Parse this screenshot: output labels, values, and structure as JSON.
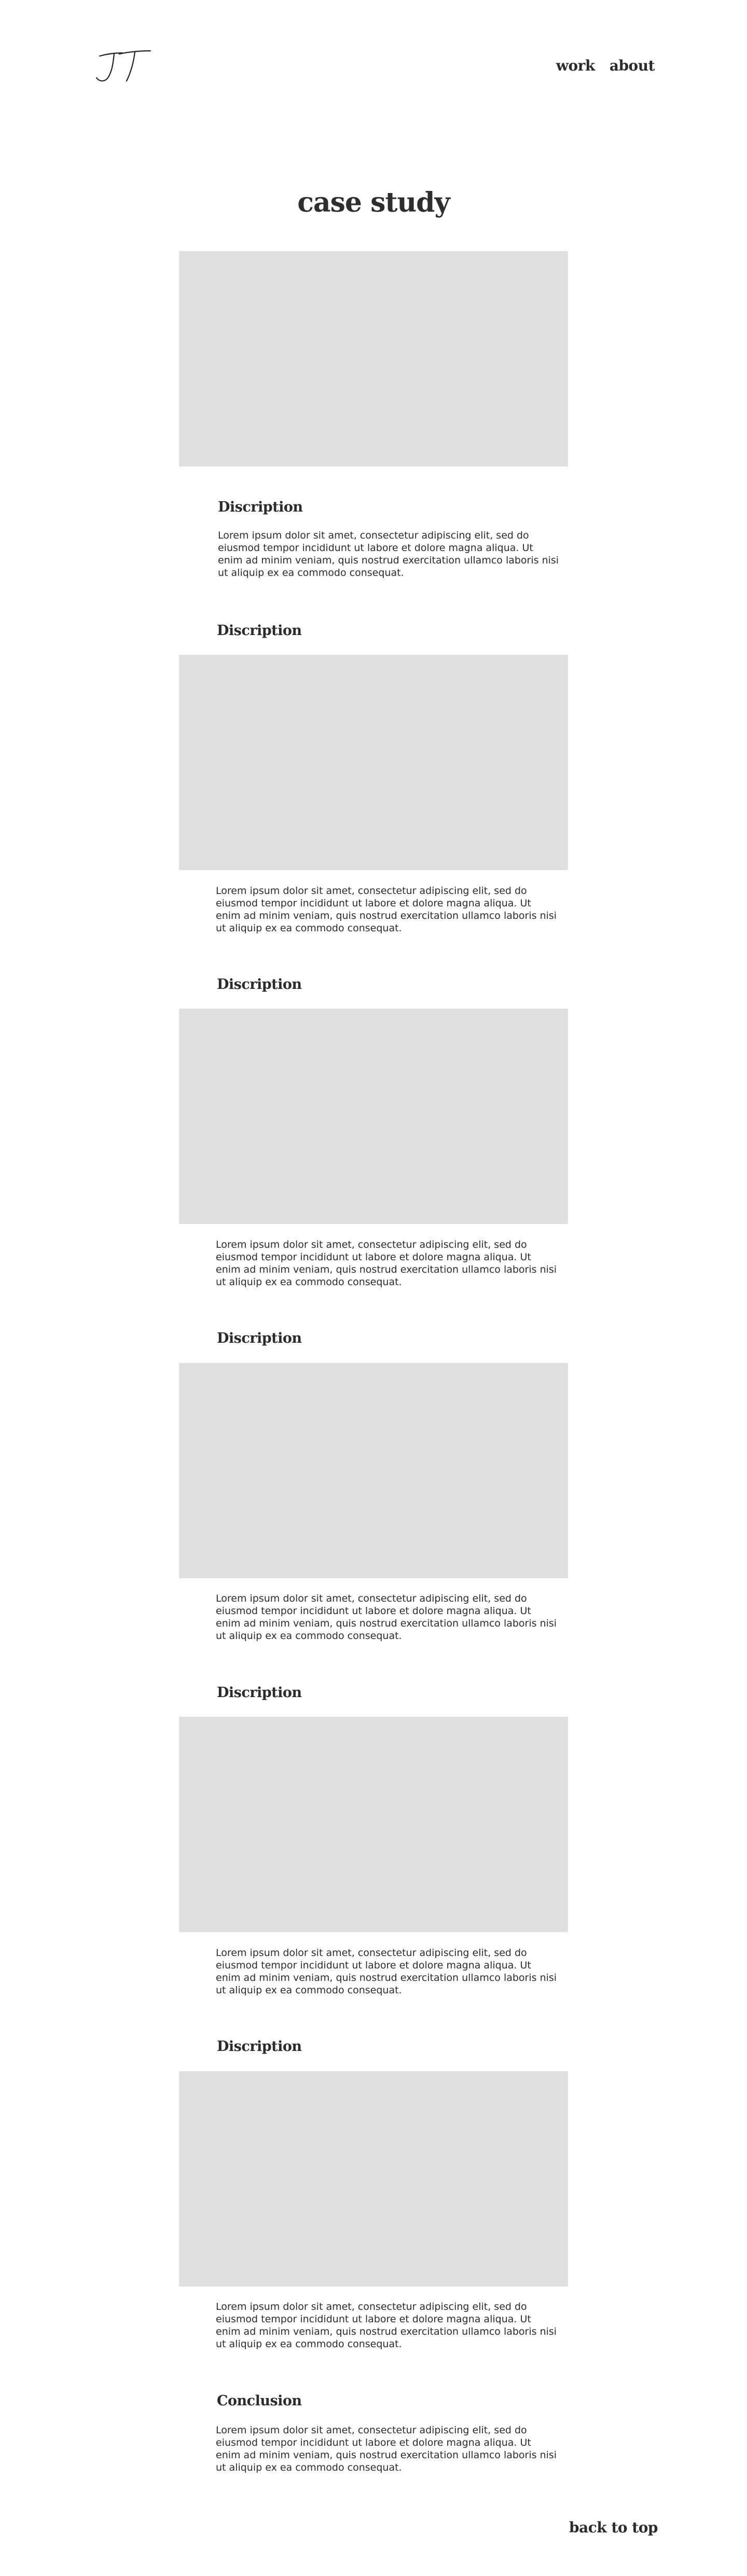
{
  "header": {
    "logo_text": "JT",
    "nav": [
      {
        "label": "work"
      },
      {
        "label": "about"
      }
    ]
  },
  "page_title": "case study",
  "intro": {
    "heading": "Discription",
    "text": "Lorem ipsum dolor sit amet, consectetur adipiscing elit, sed do eiusmod tempor incididunt ut labore et dolore magna aliqua. Ut enim ad minim veniam, quis nostrud exercitation ullamco laboris nisi ut aliquip ex ea commodo consequat."
  },
  "sections": [
    {
      "heading": "Discription",
      "text": "Lorem ipsum dolor sit amet, consectetur adipiscing elit, sed do eiusmod tempor incididunt ut labore et dolore magna aliqua. Ut enim ad minim veniam, quis nostrud exercitation ullamco laboris nisi ut aliquip ex ea commodo consequat."
    },
    {
      "heading": "Discription",
      "text": "Lorem ipsum dolor sit amet, consectetur adipiscing elit, sed do eiusmod tempor incididunt ut labore et dolore magna aliqua. Ut enim ad minim veniam, quis nostrud exercitation ullamco laboris nisi ut aliquip ex ea commodo consequat."
    },
    {
      "heading": "Discription",
      "text": "Lorem ipsum dolor sit amet, consectetur adipiscing elit, sed do eiusmod tempor incididunt ut labore et dolore magna aliqua. Ut enim ad minim veniam, quis nostrud exercitation ullamco laboris nisi ut aliquip ex ea commodo consequat."
    },
    {
      "heading": "Discription",
      "text": "Lorem ipsum dolor sit amet, consectetur adipiscing elit, sed do eiusmod tempor incididunt ut labore et dolore magna aliqua. Ut enim ad minim veniam, quis nostrud exercitation ullamco laboris nisi ut aliquip ex ea commodo consequat."
    },
    {
      "heading": "Discription",
      "text": "Lorem ipsum dolor sit amet, consectetur adipiscing elit, sed do eiusmod tempor incididunt ut labore et dolore magna aliqua. Ut enim ad minim veniam, quis nostrud exercitation ullamco laboris nisi ut aliquip ex ea commodo consequat."
    }
  ],
  "conclusion": {
    "heading": "Conclusion",
    "text": "Lorem ipsum dolor sit amet, consectetur adipiscing elit, sed do eiusmod tempor incididunt ut labore et dolore magna aliqua. Ut enim ad minim veniam, quis nostrud exercitation ullamco laboris nisi ut aliquip ex ea commodo consequat."
  },
  "back_to_top": "back to top",
  "colors": {
    "placeholder": "#e0e0e0",
    "text": "#2b2b2b",
    "background": "#ffffff"
  }
}
